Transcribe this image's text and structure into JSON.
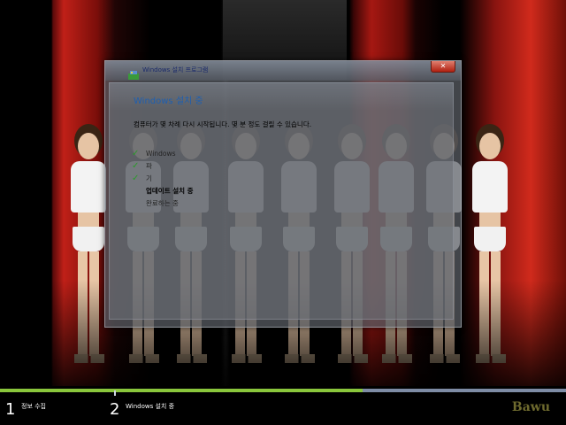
{
  "window": {
    "title": "Windows 설치 프로그램",
    "close_glyph": "✕",
    "heading": "Windows 설치 중",
    "message": "컴퓨터가 몇 차례 다시 시작됩니다. 몇 분 정도 걸릴 수 있습니다."
  },
  "steps": [
    {
      "label": "Windows",
      "status": "done"
    },
    {
      "label": "파",
      "status": "done"
    },
    {
      "label": "기",
      "status": "done"
    },
    {
      "label": "업데이트 설치 중",
      "status": "current"
    },
    {
      "label": "완료하는 중",
      "status": "pending"
    }
  ],
  "bottom": {
    "step1_number": "1",
    "step1_label": "정보 수집",
    "step2_number": "2",
    "step2_label": "Windows 설치 중",
    "progress_fraction": 0.64,
    "brand": "Bawu"
  },
  "colors": {
    "progress_done": "#8ac63c",
    "progress_track": "#7e8ca5",
    "heading": "#1e5fb0",
    "check": "#2a9a2a"
  },
  "icons": {
    "title": "setup-icon",
    "check": "check-icon",
    "close": "close-icon"
  }
}
